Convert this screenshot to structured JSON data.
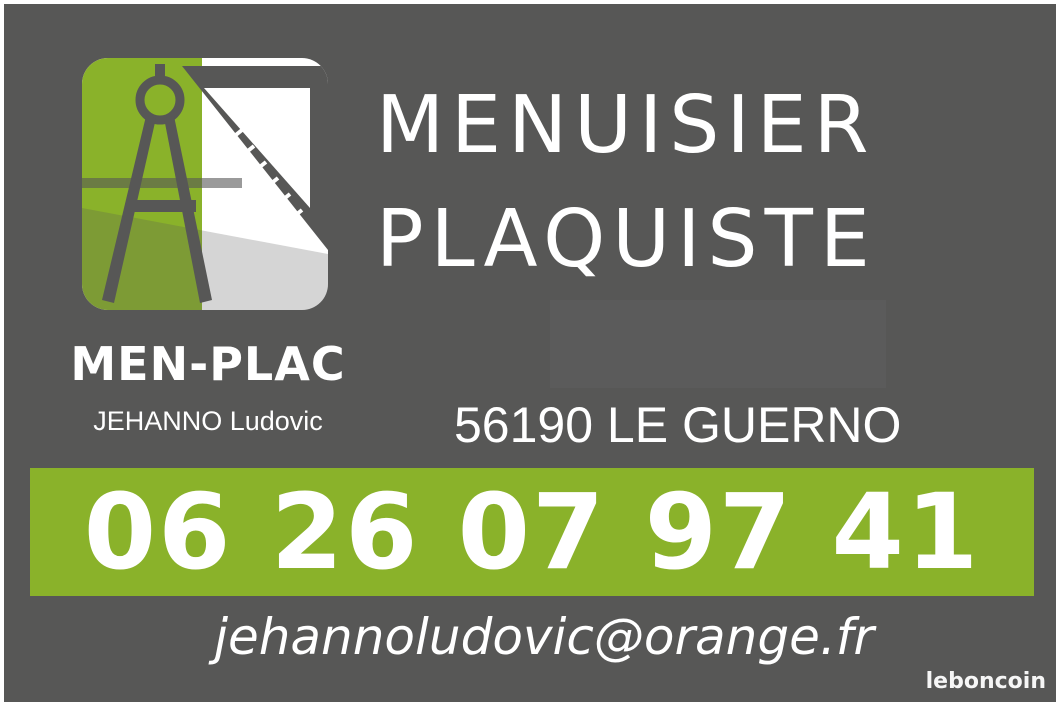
{
  "card": {
    "brand_name": "MEN-PLAC",
    "owner_name": "JEHANNO Ludovic",
    "trade_line1": "MENUISIER",
    "trade_line2": "PLAQUISTE",
    "address": "56190 LE GUERNO",
    "phone": "06 26 07 97 41",
    "email": "jehannoludovic@orange.fr",
    "logo_icon": "compass-and-set-square-icon"
  },
  "watermark": {
    "text": "leboncoin"
  },
  "colors": {
    "background": "#575756",
    "accent_green": "#8ab22a",
    "text": "#ffffff"
  }
}
